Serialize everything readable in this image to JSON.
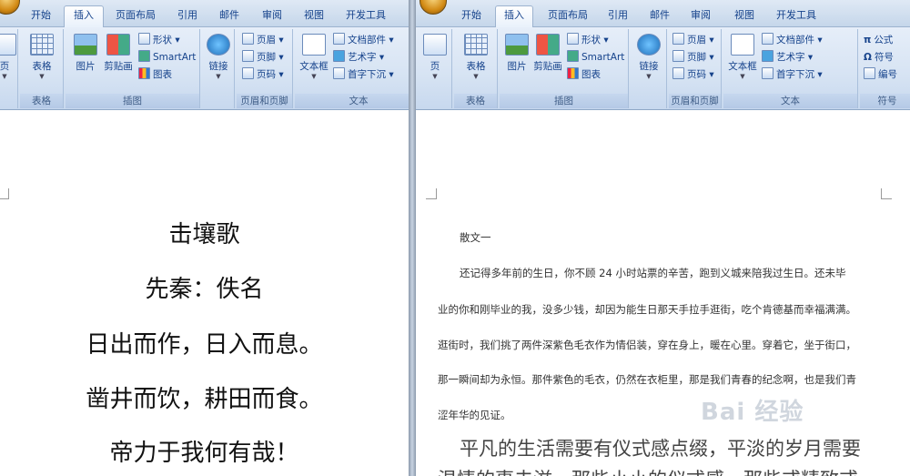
{
  "left_window": {
    "tabs": [
      "开始",
      "插入",
      "页面布局",
      "引用",
      "邮件",
      "审阅",
      "视图",
      "开发工具"
    ],
    "active_tab": "插入",
    "ribbon": {
      "partial_button": "页",
      "table_button": "表格",
      "picture_button": "图片",
      "clipart_button": "剪贴画",
      "shapes_button": "形状",
      "smartart_button": "SmartArt",
      "chart_button": "图表",
      "link_button": "链接",
      "header_button": "页眉",
      "footer_button": "页脚",
      "pagenum_button": "页码",
      "textbox_button": "文本框",
      "quickparts_button": "文档部件",
      "wordart_button": "艺术字",
      "dropcap_button": "首字下沉",
      "groups": {
        "tables": "表格",
        "illustrations": "插图",
        "header_footer": "页眉和页脚",
        "text": "文本"
      }
    },
    "poem": {
      "title": "击壤歌",
      "author": "先秦：佚名",
      "lines": [
        "日出而作，日入而息。",
        "凿井而饮，耕田而食。",
        "帝力于我何有哉！"
      ]
    }
  },
  "right_window": {
    "tabs": [
      "开始",
      "插入",
      "页面布局",
      "引用",
      "邮件",
      "审阅",
      "视图",
      "开发工具"
    ],
    "active_tab": "插入",
    "ribbon": {
      "page_button": "页",
      "table_button": "表格",
      "picture_button": "图片",
      "clipart_button": "剪贴画",
      "shapes_button": "形状",
      "smartart_button": "SmartArt",
      "chart_button": "图表",
      "link_button": "链接",
      "header_button": "页眉",
      "footer_button": "页脚",
      "pagenum_button": "页码",
      "textbox_button": "文本框",
      "quickparts_button": "文档部件",
      "wordart_button": "艺术字",
      "dropcap_button": "首字下沉",
      "formula_button": "公式",
      "symbol_button": "符号",
      "number_button": "编号",
      "groups": {
        "tables": "表格",
        "illustrations": "插图",
        "header_footer": "页眉和页脚",
        "text": "文本",
        "symbols": "符号"
      }
    },
    "document": {
      "heading": "散文一",
      "paragraph_lines": [
        "还记得多年前的生日，你不顾 24 小时站票的辛苦，跑到义城来陪我过生日。还未毕",
        "业的你和刚毕业的我，没多少钱，却因为能生日那天手拉手逛街，吃个肯德基而幸福满满。",
        "逛街时，我们挑了两件深紫色毛衣作为情侣装，穿在身上，暖在心里。穿着它，坐于街口，",
        "那一瞬间却为永恒。那件紫色的毛衣，仍然在衣柜里，那是我们青春的纪念啊，也是我们青",
        "涩年华的见证。"
      ],
      "large_lines": [
        "平凡的生活需要有仪式感点缀，平淡的岁月需要",
        "温情的事去滋，那些小小的仪式感，那些或精致或"
      ]
    },
    "watermark": "Bai 经验"
  }
}
